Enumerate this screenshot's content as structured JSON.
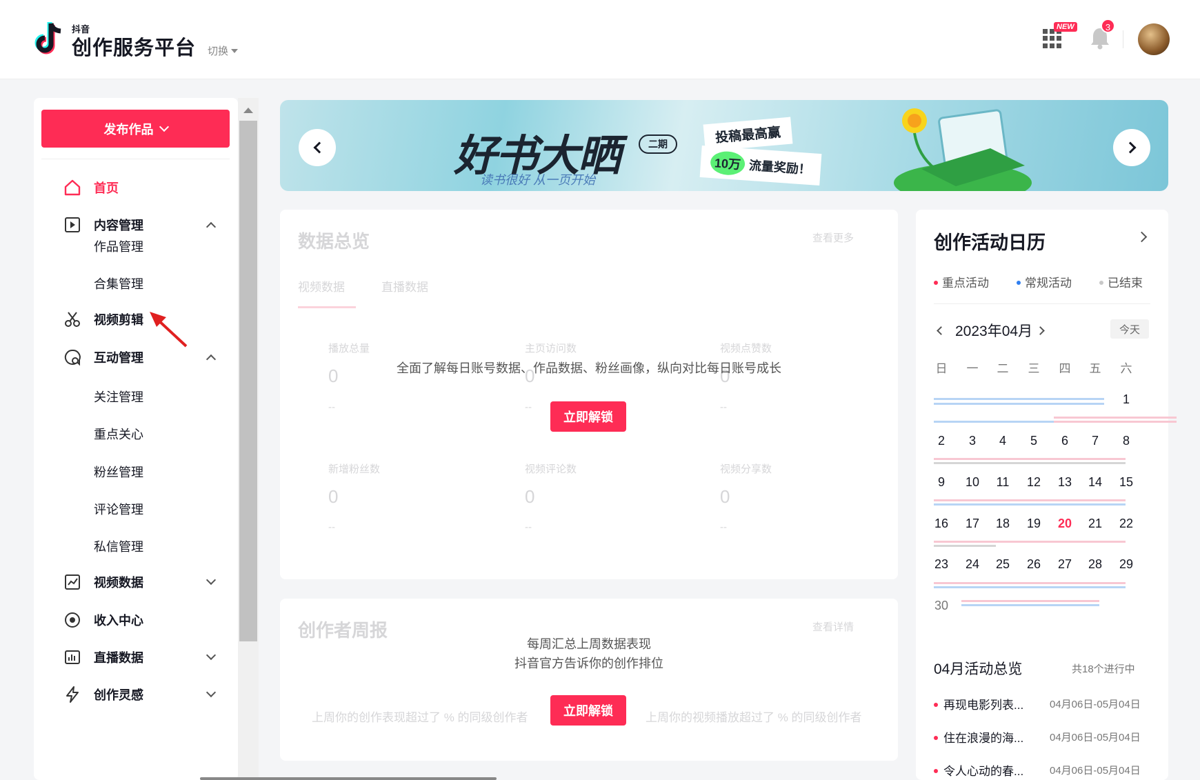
{
  "header": {
    "logo_small": "抖音",
    "logo_title": "创作服务平台",
    "switch_label": "切换",
    "new_badge": "NEW",
    "notification_count": "3",
    "brand_color": "#fe2c55"
  },
  "sidebar": {
    "publish_label": "发布作品",
    "items": [
      {
        "label": "首页",
        "icon": "home-icon",
        "active": true
      },
      {
        "label": "内容管理",
        "icon": "play-square-icon",
        "expanded": true,
        "children": [
          "作品管理",
          "合集管理"
        ]
      },
      {
        "label": "视频剪辑",
        "icon": "scissors-icon"
      },
      {
        "label": "互动管理",
        "icon": "chat-icon",
        "expanded": true,
        "children": [
          "关注管理",
          "重点关心",
          "粉丝管理",
          "评论管理",
          "私信管理"
        ]
      },
      {
        "label": "视频数据",
        "icon": "chart-icon",
        "expanded": false
      },
      {
        "label": "收入中心",
        "icon": "coin-icon"
      },
      {
        "label": "直播数据",
        "icon": "live-data-icon",
        "expanded": false
      },
      {
        "label": "创作灵感",
        "icon": "lightning-icon",
        "expanded": false
      }
    ]
  },
  "banner": {
    "title": "好书大晒",
    "issue": "二期",
    "script": "读书很好 从一页开始",
    "tag1": "投稿最高赢",
    "tag2_highlight": "10万",
    "tag2": "流量奖励！"
  },
  "data_overview": {
    "title": "数据总览",
    "more": "查看更多",
    "tabs": [
      "视频数据",
      "直播数据"
    ],
    "metrics": [
      {
        "label": "播放总量",
        "value": "0",
        "compare": "--"
      },
      {
        "label": "主页访问数",
        "value": "0",
        "compare": "--"
      },
      {
        "label": "视频点赞数",
        "value": "0",
        "compare": "--"
      },
      {
        "label": "新增粉丝数",
        "value": "0",
        "compare": "--"
      },
      {
        "label": "视频评论数",
        "value": "0",
        "compare": "--"
      },
      {
        "label": "视频分享数",
        "value": "0",
        "compare": "--"
      }
    ],
    "lock_text": "全面了解每日账号数据、作品数据、粉丝画像，纵向对比每日账号成长",
    "unlock_label": "立即解锁"
  },
  "weekly": {
    "title": "创作者周报",
    "more": "查看详情",
    "desc1": "每周汇总上周数据表现",
    "desc2": "抖音官方告诉你的创作排位",
    "left_text": "上周你的创作表现超过了 % 的同级创作者",
    "right_text": "上周你的视频播放超过了 % 的同级创作者",
    "unlock_label": "立即解锁"
  },
  "calendar": {
    "title": "创作活动日历",
    "legend": [
      {
        "label": "重点活动",
        "color": "#fe2c55"
      },
      {
        "label": "常规活动",
        "color": "#2f7ff0"
      },
      {
        "label": "已结束",
        "color": "#c8c8c8"
      }
    ],
    "month": "2023年04月",
    "today_label": "今天",
    "weekdays": [
      "日",
      "一",
      "二",
      "三",
      "四",
      "五",
      "六"
    ],
    "today_day": 20,
    "overview_title": "04月活动总览",
    "overview_count": "共18个进行中",
    "activities": [
      {
        "name": "再现电影列表...",
        "date": "04月06日-05月04日"
      },
      {
        "name": "住在浪漫的海...",
        "date": "04月06日-05月04日"
      },
      {
        "name": "令人心动的春...",
        "date": "04月06日-05月04日"
      }
    ]
  }
}
